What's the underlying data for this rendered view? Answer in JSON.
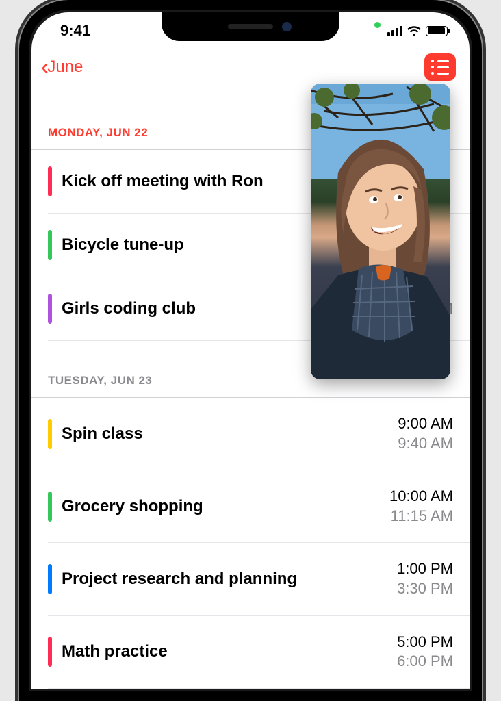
{
  "status": {
    "time": "9:41"
  },
  "nav": {
    "back_label": "June"
  },
  "sections": [
    {
      "header": "MONDAY, JUN 22",
      "today": true,
      "events": [
        {
          "title": "Kick off meeting with Ron",
          "color": "#ff2d55",
          "start": "",
          "end": ""
        },
        {
          "title": "Bicycle tune-up",
          "color": "#34c759",
          "start": "",
          "end": ""
        },
        {
          "title": "Girls coding club",
          "color": "#af52de",
          "start": "",
          "end": "4:30 PM"
        }
      ]
    },
    {
      "header": "TUESDAY, JUN 23",
      "today": false,
      "events": [
        {
          "title": "Spin class",
          "color": "#ffcc00",
          "start": "9:00 AM",
          "end": "9:40 AM"
        },
        {
          "title": "Grocery shopping",
          "color": "#34c759",
          "start": "10:00 AM",
          "end": "11:15 AM"
        },
        {
          "title": "Project research and planning",
          "color": "#007aff",
          "start": "1:00 PM",
          "end": "3:30 PM"
        },
        {
          "title": "Math practice",
          "color": "#ff2d55",
          "start": "5:00 PM",
          "end": "6:00 PM"
        }
      ]
    }
  ],
  "pip": {
    "description": "facetime-video-call"
  }
}
